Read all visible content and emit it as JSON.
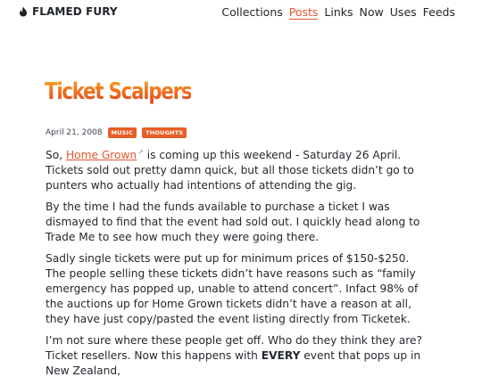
{
  "header": {
    "brand": "FLAMED FURY",
    "nav": [
      "Collections",
      "Posts",
      "Links",
      "Now",
      "Uses",
      "Feeds"
    ],
    "active": "Posts"
  },
  "post": {
    "title": "Ticket Scalpers",
    "date": "April 21, 2008",
    "tags": [
      "MUSIC",
      "THOUGHTS"
    ],
    "p1_pre": "So, ",
    "p1_link": "Home Grown",
    "p1_ext": "↗",
    "p1_post": " is coming up this weekend - Saturday 26 April. Tickets sold out pretty damn quick, but all those tickets didn’t go to punters who actually had intentions of attending the gig.",
    "p2": "By the time I had the funds available to purchase a ticket I was dismayed to find that the event had sold out. I quickly head along to Trade Me to see how much they were going there.",
    "p3": "Sadly single tickets were put up for minimum prices of $150-$250. The people selling these tickets didn’t have reasons such as “family emergency has popped up, unable to attend concert”. Infact 98% of the auctions up for Home Grown tickets didn’t have a reason at all, they have just copy/pasted the event listing directly from Ticketek.",
    "p4_pre": "I’m not sure where these people get off. Who do they think they are? Ticket resellers. Now this happens with ",
    "p4_strong": "EVERY",
    "p4_post": " event that pops up in New Zealand,"
  },
  "colors": {
    "accent": "#e4572e",
    "tag_bg": "#e85d26"
  }
}
